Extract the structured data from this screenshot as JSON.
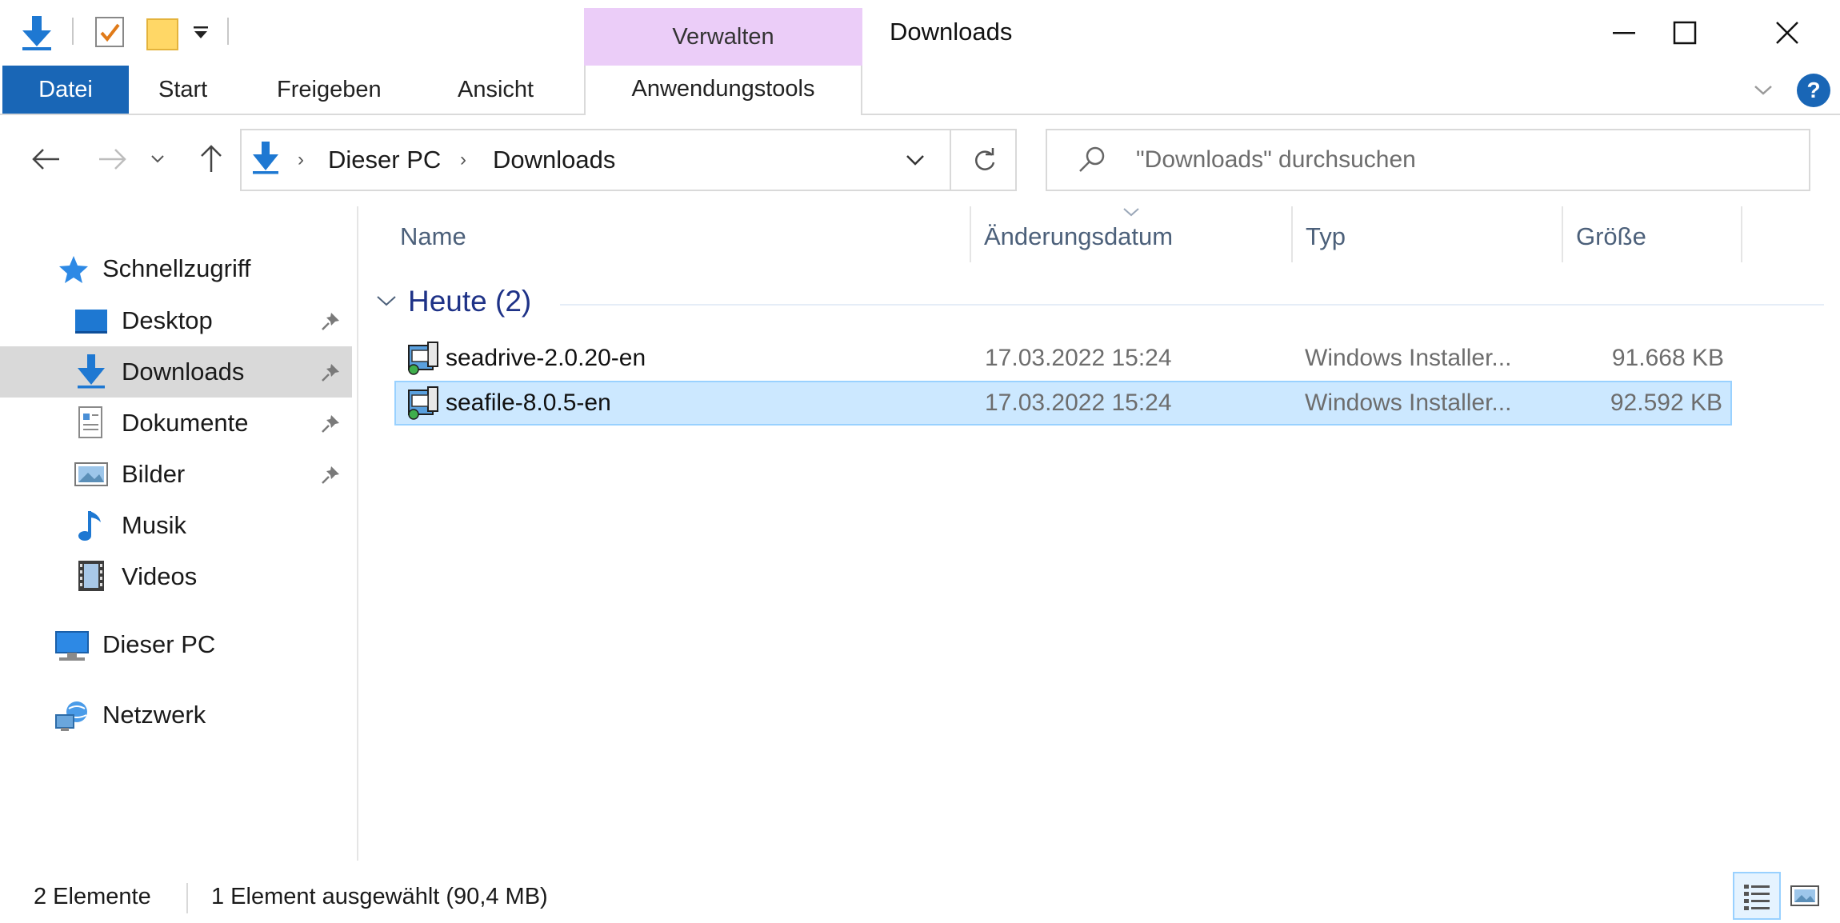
{
  "window": {
    "title": "Downloads",
    "contextual_tab": "Verwalten"
  },
  "ribbon": {
    "tabs": [
      "Datei",
      "Start",
      "Freigeben",
      "Ansicht"
    ],
    "contextual_subtab": "Anwendungstools"
  },
  "address": {
    "crumbs": [
      "Dieser PC",
      "Downloads"
    ]
  },
  "search": {
    "placeholder": "\"Downloads\" durchsuchen"
  },
  "sidebar": {
    "quick_access": "Schnellzugriff",
    "items": [
      {
        "label": "Desktop",
        "icon": "desktop-icon",
        "pinned": true
      },
      {
        "label": "Downloads",
        "icon": "downloads-icon",
        "pinned": true,
        "selected": true
      },
      {
        "label": "Dokumente",
        "icon": "documents-icon",
        "pinned": true
      },
      {
        "label": "Bilder",
        "icon": "pictures-icon",
        "pinned": true
      },
      {
        "label": "Musik",
        "icon": "music-icon",
        "pinned": false
      },
      {
        "label": "Videos",
        "icon": "videos-icon",
        "pinned": false
      }
    ],
    "this_pc": "Dieser PC",
    "network": "Netzwerk"
  },
  "columns": {
    "name": "Name",
    "date": "Änderungsdatum",
    "type": "Typ",
    "size": "Größe"
  },
  "group": {
    "title": "Heute (2)"
  },
  "files": [
    {
      "name": "seadrive-2.0.20-en",
      "date": "17.03.2022 15:24",
      "type": "Windows Installer...",
      "size": "91.668 KB",
      "selected": false
    },
    {
      "name": "seafile-8.0.5-en",
      "date": "17.03.2022 15:24",
      "type": "Windows Installer...",
      "size": "92.592 KB",
      "selected": true
    }
  ],
  "status": {
    "count": "2 Elemente",
    "selection": "1 Element ausgewählt (90,4 MB)"
  },
  "colors": {
    "accent": "#1966b6",
    "contextual": "#ebcdf8",
    "selection": "#cce8ff",
    "group_title": "#1e3287"
  }
}
